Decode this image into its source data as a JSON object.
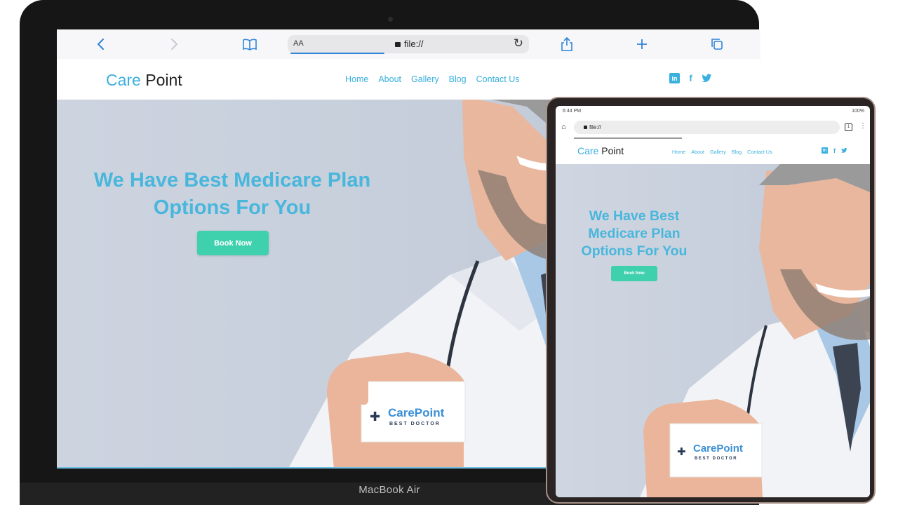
{
  "laptop": {
    "brand_label": "MacBook Air",
    "browser": {
      "text_size_label": "AA",
      "address": "file://"
    },
    "site": {
      "logo_care": "Care",
      "logo_point": " Point",
      "nav": [
        "Home",
        "About",
        "Gallery",
        "Blog",
        "Contact Us"
      ],
      "hero_title": "We Have Best Medicare Plan Options For You",
      "book_button": "Book Now",
      "card_brand": "CarePoint",
      "card_tagline": "BEST DOCTOR"
    }
  },
  "tablet": {
    "status": {
      "time": "6:44 PM",
      "battery": "100%"
    },
    "browser": {
      "address": "file://",
      "tab_count": "1"
    },
    "site": {
      "logo_care": "Care",
      "logo_point": " Point",
      "nav": [
        "Home",
        "About",
        "Gallery",
        "Blog",
        "Contact Us"
      ],
      "hero_title": "We Have Best Medicare Plan Options For You",
      "book_button": "Book Now",
      "card_brand": "CarePoint",
      "card_tagline": "BEST DOCTOR"
    }
  },
  "icons": {
    "social": [
      "linkedin-icon",
      "facebook-icon",
      "twitter-icon"
    ]
  },
  "colors": {
    "accent": "#3ab0de",
    "button": "#3fd0ae",
    "hero_bg": "#c6cedb"
  }
}
